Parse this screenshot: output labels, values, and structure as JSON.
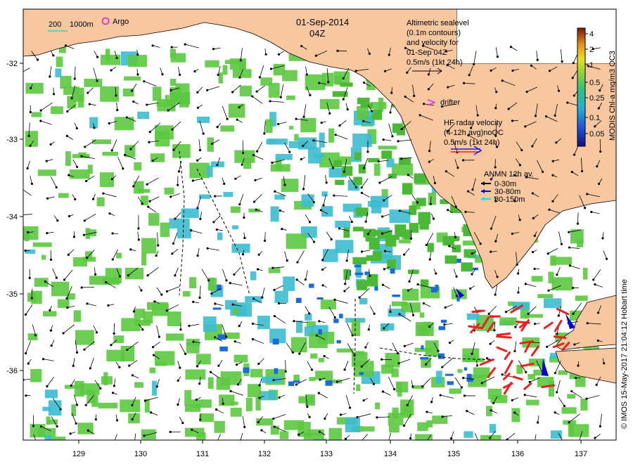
{
  "header": {
    "date": "01-Sep-2014",
    "time": "04Z",
    "isobath_labels": [
      "200",
      "1000m"
    ],
    "argo_label": "Argo"
  },
  "altimetry_legend": {
    "lines": [
      "Altimetric sealevel",
      "(0.1m contours)",
      "and velocity for",
      "01-Sep 04Z",
      "0.5m/s (1kt 24h)"
    ]
  },
  "drifter_legend": {
    "glyph": ">",
    "label": "drifter"
  },
  "hf_radar_legend": {
    "lines": [
      "HF radar velocity",
      "(4-12h avg)noQC",
      "0.5m/s (1kt 24h)"
    ]
  },
  "anmn_legend": {
    "title": "ANMN 12h av.",
    "items": [
      {
        "label": "0-30m",
        "color": "#000000"
      },
      {
        "label": "30-80m",
        "color": "#0000dd"
      },
      {
        "label": "80-150m",
        "color": "#22dddd"
      }
    ]
  },
  "colorbar": {
    "title": "MODIS Chl-a mg/m3 OC3",
    "ticks": [
      "4",
      "2",
      "1",
      "0.5",
      "0.25",
      "0.1",
      "0.05"
    ]
  },
  "credit": "© IMOS 15-May-2017 21:04:12 Hobart time",
  "axes": {
    "x_ticks": [
      "129",
      "130",
      "131",
      "132",
      "133",
      "134",
      "135",
      "136",
      "137"
    ],
    "y_ticks": [
      "-32",
      "-33",
      "-34",
      "-35",
      "-36"
    ]
  },
  "colors": {
    "land": "#f7c8a0",
    "chl_green": "#5cc840",
    "chl_cyan": "#3cbcd0",
    "chl_blue": "#1a6ad8",
    "hf_radar": "#e82020"
  }
}
